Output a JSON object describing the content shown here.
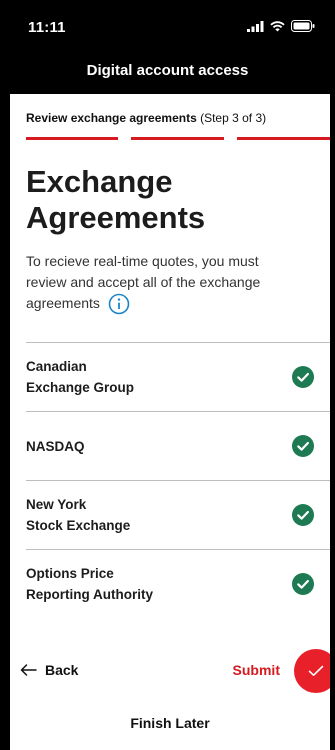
{
  "status_bar": {
    "time": "11:11"
  },
  "header": {
    "title": "Digital account access"
  },
  "step": {
    "title": "Review exchange agreements",
    "counter": "(Step 3 of 3)"
  },
  "page": {
    "title_line1": "Exchange",
    "title_line2": "Agreements",
    "intro": "To recieve real-time quotes, you must review and accept all of the exchange agreements"
  },
  "agreements": [
    {
      "line1": "Canadian",
      "line2": "Exchange Group",
      "accepted": true
    },
    {
      "line1": "NASDAQ",
      "line2": "",
      "accepted": true
    },
    {
      "line1": "New York",
      "line2": "Stock Exchange",
      "accepted": true
    },
    {
      "line1": "Options Price",
      "line2": "Reporting Authority",
      "accepted": true
    }
  ],
  "footer": {
    "back_label": "Back",
    "submit_label": "Submit",
    "finish_later_label": "Finish Later"
  },
  "colors": {
    "accent_red": "#d51a20",
    "check_green": "#1e7a53",
    "header_bg": "#000000"
  }
}
